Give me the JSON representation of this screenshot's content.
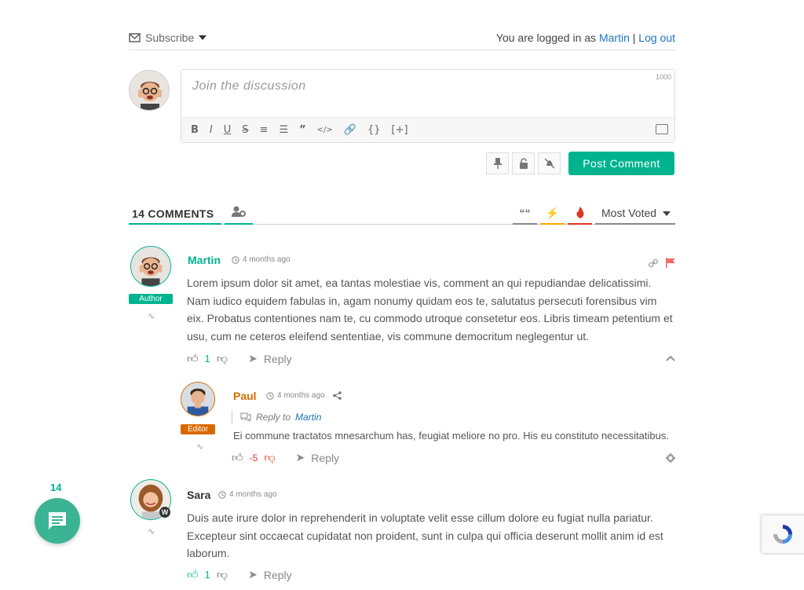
{
  "topbar": {
    "subscribe_label": "Subscribe",
    "logged_prefix": "You are logged in as",
    "user_name": "Martin",
    "separator": "|",
    "logout_label": "Log out"
  },
  "editor": {
    "placeholder": "Join the discussion",
    "char_limit": "1000",
    "toolbar": [
      "B",
      "I",
      "U",
      "S",
      "ol",
      "ul",
      "”",
      "</>",
      "link",
      "{}",
      "[+]"
    ]
  },
  "post_button": "Post Comment",
  "comments_header": {
    "count_label": "14 COMMENTS",
    "sort_label": "Most Voted"
  },
  "comments": [
    {
      "author": "Martin",
      "time": "4 months ago",
      "badge": "Author",
      "name_color": "#00b38f",
      "badge_color": "#00b38f",
      "text": "Lorem ipsum dolor sit amet, ea tantas molestiae vis, comment an qui repudiandae delicatissimi. Nam iudico equidem fabulas in, agam nonumy quidam eos te, salutatus persecuti forensibus vim eix. Probatus contentiones nam te, cu commodo utroque consetetur eos. Libris timeam petentium et usu, cum ne ceteros eleifend sententiae, vis commune democritum neglegentur ut.",
      "votes": "1",
      "reply_label": "Reply"
    },
    {
      "author": "Paul",
      "time": "4 months ago",
      "badge": "Editor",
      "name_color": "#d86a00",
      "badge_color": "#d86a00",
      "reply_to_prefix": "Reply to",
      "reply_to_name": "Martin",
      "text": "Ei commune tractatos mnesarchum has, feugiat meliore no pro. His eu constituto necessitatibus.",
      "votes": "-5",
      "reply_label": "Reply"
    },
    {
      "author": "Sara",
      "time": "4 months ago",
      "name_color": "#333333",
      "text": "Duis aute irure dolor in reprehenderit in voluptate velit esse cillum dolore eu fugiat nulla pariatur. Excepteur sint occaecat cupidatat non proident, sunt in culpa qui officia deserunt mollit anim id est laborum.",
      "votes": "1",
      "reply_label": "Reply"
    }
  ],
  "floating": {
    "count": "14"
  },
  "colors": {
    "accent": "#00b38f",
    "link": "#1e73be",
    "negative": "#e0361e"
  }
}
